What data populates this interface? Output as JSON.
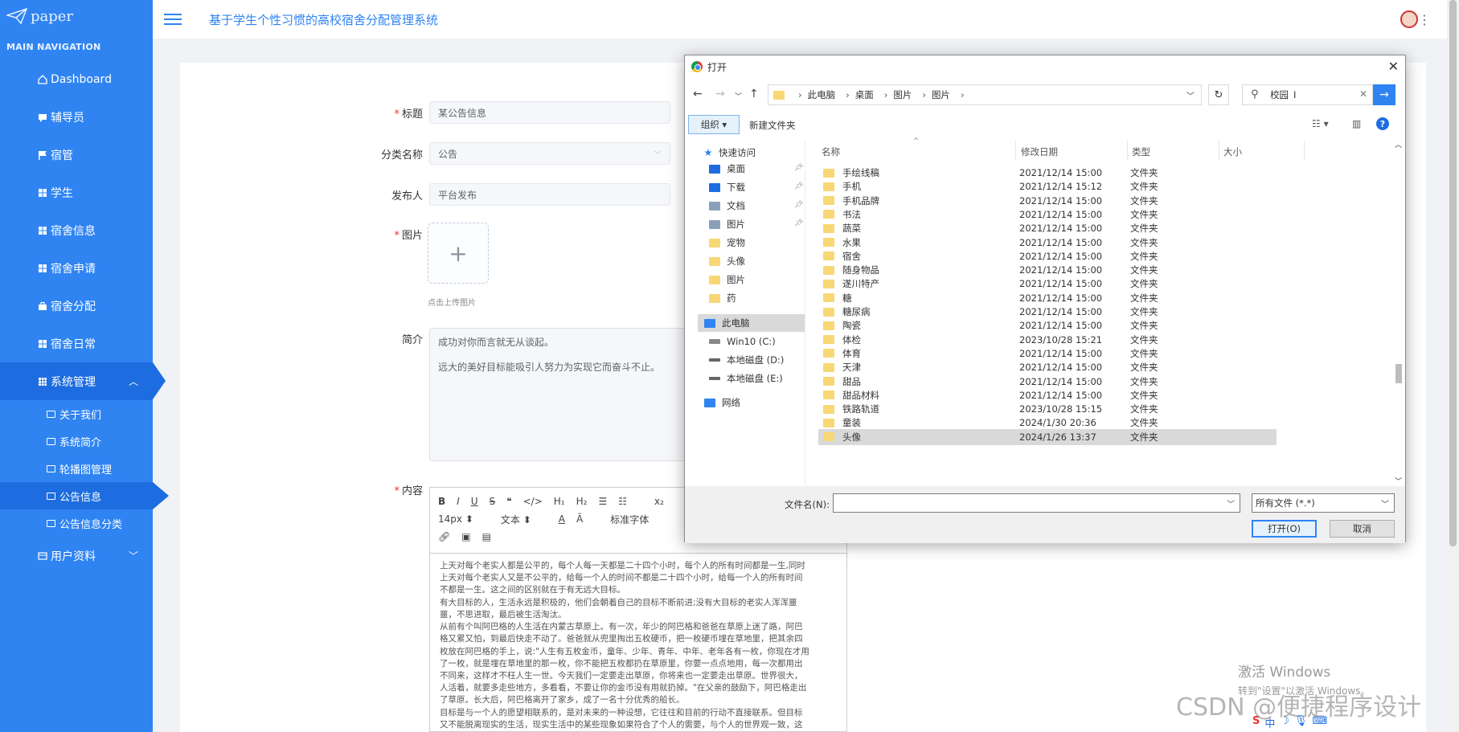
{
  "sidebar": {
    "logo": "paper",
    "nav_title": "MAIN NAVIGATION",
    "items": [
      {
        "label": "Dashboard"
      },
      {
        "label": "辅导员"
      },
      {
        "label": "宿管"
      },
      {
        "label": "学生"
      },
      {
        "label": "宿舍信息"
      },
      {
        "label": "宿舍申请"
      },
      {
        "label": "宿舍分配"
      },
      {
        "label": "宿舍日常"
      },
      {
        "label": "系统管理"
      }
    ],
    "sub_items": [
      {
        "label": "关于我们"
      },
      {
        "label": "系统简介"
      },
      {
        "label": "轮播图管理"
      },
      {
        "label": "公告信息"
      },
      {
        "label": "公告信息分类"
      }
    ],
    "last_item": {
      "label": "用户资料"
    }
  },
  "header": {
    "title": "基于学生个性习惯的高校宿舍分配管理系统"
  },
  "form": {
    "title_label": "标题",
    "title_value": "某公告信息",
    "category_label": "分类名称",
    "category_value": "公告",
    "publisher_label": "发布人",
    "publisher_value": "平台发布",
    "image_label": "图片",
    "upload_hint": "点击上传图片",
    "intro_label": "简介",
    "intro_lines": [
      "成功对你而言就无从谈起。",
      "远大的美好目标能吸引人努力为实现它而奋斗不止。"
    ],
    "content_label": "内容",
    "toolbar": {
      "font_size": "14px",
      "block_type": "文本",
      "font_family": "标准字体"
    },
    "content_lines": [
      "上天对每个老实人都是公平的，每个人每一天都是二十四个小时，每个人的所有时间都是一生,同时",
      "上天对每个老实人又是不公平的，给每一个人的时间不都是二十四个小时，给每一个人的所有时间",
      "不都是一生。这之间的区别就在于有无远大目标。",
      "有大目标的人，生活永远是积极的，他们会朝着自己的目标不断前进;没有大目标的老实人浑浑噩",
      "噩，不思进取，最后被生活淘汰。",
      "从前有个叫阿巴格的人生活在内蒙古草原上。有一次，年少的阿巴格和爸爸在草原上迷了路，阿巴",
      "格又累又怕，到最后快走不动了。爸爸就从兜里掏出五枚硬币，把一枚硬币埋在草地里，把其余四",
      "枚放在阿巴格的手上，说:\"人生有五枚金币，童年、少年、青年、中年、老年各有一枚，你现在才用",
      "了一枚，就是埋在草地里的那一枚，你不能把五枚都扔在草原里，你要一点点地用，每一次都用出",
      "不同来，这样才不枉人生一世。今天我们一定要走出草原，你将来也一定要走出草原。世界很大，",
      "人活着，就要多走些地方，多看看，不要让你的金币没有用就扔掉。\"在父亲的鼓励下，阿巴格走出",
      "了草原。长大后，阿巴格离开了家乡，成了一名十分优秀的船长。",
      "目标是与一个人的愿望相联系的，是对未来的一种设想，它往往和目前的行动不直接联系。但目标",
      "又不能脱离现实的生活，现实生活中的某些现象如果符合了个人的需要，与个人的世界观一致，这"
    ]
  },
  "dialog": {
    "title": "打开",
    "breadcrumb": [
      "此电脑",
      "桌面",
      "图片",
      "图片"
    ],
    "search_value": "校园",
    "organize_label": "组织 ▾",
    "new_folder_label": "新建文件夹",
    "tree": [
      {
        "label": "快速访问",
        "color": "#2f84f2"
      },
      {
        "label": "桌面",
        "color": "#1d6de0"
      },
      {
        "label": "下载",
        "color": "#1d6de0"
      },
      {
        "label": "文档",
        "color": "#8aa0b8"
      },
      {
        "label": "图片",
        "color": "#8aa0b8"
      },
      {
        "label": "宠物",
        "color": "#f8d775"
      },
      {
        "label": "头像",
        "color": "#f8d775"
      },
      {
        "label": "图片",
        "color": "#f8d775"
      },
      {
        "label": "药",
        "color": "#f8d775"
      },
      {
        "label": "此电脑",
        "color": "#2f84f2"
      },
      {
        "label": "Win10 (C:)",
        "color": "#888"
      },
      {
        "label": "本地磁盘 (D:)",
        "color": "#666"
      },
      {
        "label": "本地磁盘 (E:)",
        "color": "#666"
      },
      {
        "label": "网络",
        "color": "#2f84f2"
      }
    ],
    "columns": [
      "名称",
      "修改日期",
      "类型",
      "大小"
    ],
    "files": [
      {
        "name": "手绘线稿",
        "date": "2021/12/14 15:00",
        "type": "文件夹"
      },
      {
        "name": "手机",
        "date": "2021/12/14 15:12",
        "type": "文件夹"
      },
      {
        "name": "手机品牌",
        "date": "2021/12/14 15:00",
        "type": "文件夹"
      },
      {
        "name": "书法",
        "date": "2021/12/14 15:00",
        "type": "文件夹"
      },
      {
        "name": "蔬菜",
        "date": "2021/12/14 15:00",
        "type": "文件夹"
      },
      {
        "name": "水果",
        "date": "2021/12/14 15:00",
        "type": "文件夹"
      },
      {
        "name": "宿舍",
        "date": "2021/12/14 15:00",
        "type": "文件夹"
      },
      {
        "name": "随身物品",
        "date": "2021/12/14 15:00",
        "type": "文件夹"
      },
      {
        "name": "遂川特产",
        "date": "2021/12/14 15:00",
        "type": "文件夹"
      },
      {
        "name": "糖",
        "date": "2021/12/14 15:00",
        "type": "文件夹"
      },
      {
        "name": "糖尿病",
        "date": "2021/12/14 15:00",
        "type": "文件夹"
      },
      {
        "name": "陶瓷",
        "date": "2021/12/14 15:00",
        "type": "文件夹"
      },
      {
        "name": "体检",
        "date": "2023/10/28 15:21",
        "type": "文件夹"
      },
      {
        "name": "体育",
        "date": "2021/12/14 15:00",
        "type": "文件夹"
      },
      {
        "name": "天津",
        "date": "2021/12/14 15:00",
        "type": "文件夹"
      },
      {
        "name": "甜品",
        "date": "2021/12/14 15:00",
        "type": "文件夹"
      },
      {
        "name": "甜品材料",
        "date": "2021/12/14 15:00",
        "type": "文件夹"
      },
      {
        "name": "铁路轨道",
        "date": "2023/10/28 15:15",
        "type": "文件夹"
      },
      {
        "name": "童装",
        "date": "2024/1/30 20:36",
        "type": "文件夹"
      },
      {
        "name": "头像",
        "date": "2024/1/26 13:37",
        "type": "文件夹"
      }
    ],
    "filename_label": "文件名(N):",
    "filename_value": "",
    "filter_value": "所有文件 (*.*)",
    "open_label": "打开(O)",
    "cancel_label": "取消"
  },
  "watermarks": {
    "windows_line1": "激活 Windows",
    "windows_line2": "转到\"设置\"以激活 Windows。",
    "csdn": "CSDN @便捷程序设计"
  },
  "colors": {
    "sidebar": "#2f84f2",
    "sidebar_active": "#1d6de0",
    "accent": "#2f84f2"
  }
}
